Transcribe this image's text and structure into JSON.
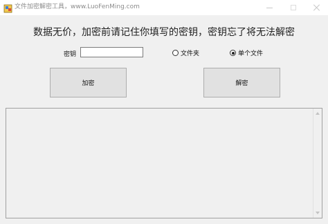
{
  "window": {
    "title": "文件加密解密工具，www.LuoFenMing.com"
  },
  "headline": "数据无价，加密前请记住你填写的密钥，密钥忘了将无法解密",
  "key": {
    "label": "密钥",
    "value": "",
    "placeholder": ""
  },
  "mode": {
    "options": [
      {
        "label": "文件夹",
        "checked": false
      },
      {
        "label": "单个文件",
        "checked": true
      }
    ]
  },
  "buttons": {
    "encrypt_label": "加密",
    "decrypt_label": "解密"
  },
  "log": {
    "text": ""
  },
  "icons": {
    "app": "app-icon",
    "minimize": "minimize-icon",
    "maximize": "maximize-icon",
    "close": "close-icon"
  }
}
